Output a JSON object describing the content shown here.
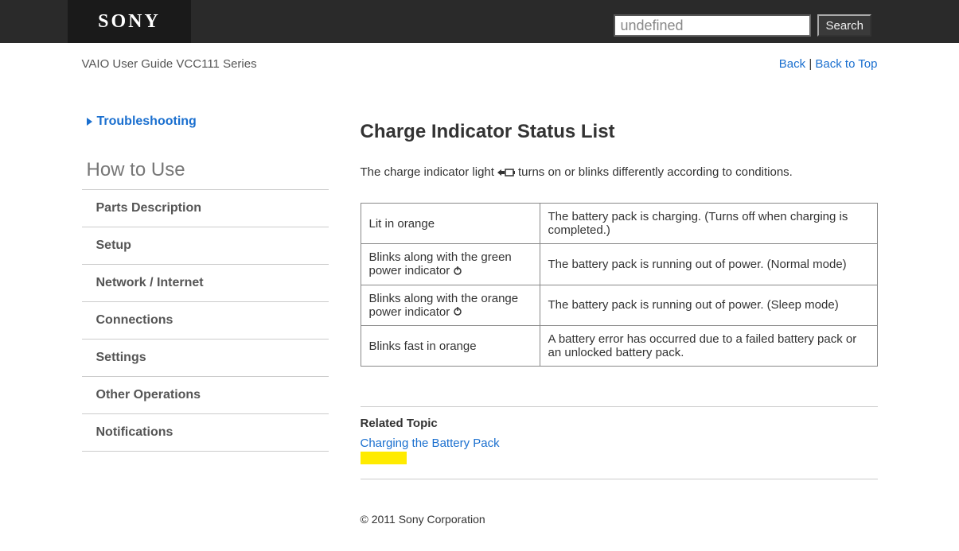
{
  "header": {
    "logo": "SONY",
    "search_value": "undefined",
    "search_button": "Search"
  },
  "breadcrumb": {
    "guide": "VAIO User Guide VCC111 Series",
    "back": "Back",
    "back_to_top": "Back to Top"
  },
  "sidebar": {
    "troubleshooting": "Troubleshooting",
    "howto": "How to Use",
    "items": [
      "Parts Description",
      "Setup",
      "Network / Internet",
      "Connections",
      "Settings",
      "Other Operations",
      "Notifications"
    ]
  },
  "main": {
    "title": "Charge Indicator Status List",
    "intro_before": "The charge indicator light",
    "intro_after": "turns on or blinks differently according to conditions.",
    "table": [
      {
        "status": "Lit in orange",
        "desc": "The battery pack is charging. (Turns off when charging is completed.)",
        "icon": false
      },
      {
        "status": "Blinks along with the green power indicator",
        "desc": "The battery pack is running out of power. (Normal mode)",
        "icon": true
      },
      {
        "status": "Blinks along with the orange power indicator",
        "desc": "The battery pack is running out of power. (Sleep mode)",
        "icon": true
      },
      {
        "status": "Blinks fast in orange",
        "desc": "A battery error has occurred due to a failed battery pack or an unlocked battery pack.",
        "icon": false
      }
    ],
    "related_heading": "Related Topic",
    "related_link": "Charging the Battery Pack"
  },
  "footer": {
    "copyright": "© 2011 Sony Corporation"
  }
}
